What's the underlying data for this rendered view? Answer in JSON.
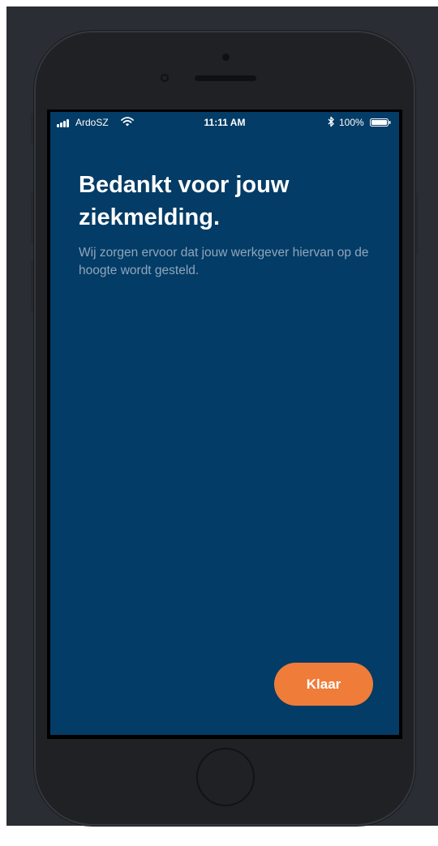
{
  "status_bar": {
    "carrier": "ArdoSZ",
    "time": "11:11 AM",
    "battery": "100%"
  },
  "screen": {
    "title": "Bedankt voor jouw ziekmelding.",
    "message": "Wij zorgen ervoor dat jouw werkgever hiervan op de hoogte wordt gesteld.",
    "done_label": "Klaar"
  },
  "colors": {
    "background": "#033c66",
    "accent": "#f07c3a",
    "message_text": "#8fa6bb",
    "device_frame": "#1f2125"
  },
  "icons": [
    "signal-icon",
    "wifi-icon",
    "bluetooth-icon",
    "battery-icon"
  ]
}
